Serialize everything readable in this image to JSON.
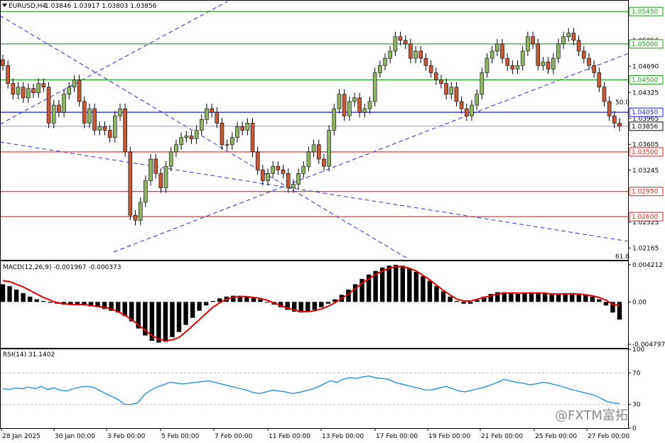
{
  "header": {
    "symbol": "EURUSD,H4",
    "ohlc": "1.03846 1.03917 1.03803 1.03856",
    "triangle_icon": "triangle-down-icon"
  },
  "colors": {
    "bull": "#90b466",
    "bear": "#c25a3a",
    "wick": "#000000",
    "support": "#e02020",
    "resistance": "#1a9a1a",
    "pivot": "#1a1aff",
    "trend": "#2a2acc",
    "macd_line": "#e00000",
    "hist": "#000000",
    "rsi": "#2b8fd6",
    "bid_line": "#8a8ab8"
  },
  "price_axis": {
    "ticks": [
      "1.04325",
      "1.03965",
      "1.03605",
      "1.03245",
      "1.02525",
      "1.02165",
      "1.04690",
      "1.05050"
    ],
    "levels": [
      {
        "label": "1.05450",
        "kind": "resistance"
      },
      {
        "label": "1.05000",
        "kind": "resistance"
      },
      {
        "label": "1.04500",
        "kind": "resistance"
      },
      {
        "label": "1.04050",
        "kind": "pivot"
      },
      {
        "label": "1.03856",
        "kind": "bid"
      },
      {
        "label": "1.03500",
        "kind": "support"
      },
      {
        "label": "1.02950",
        "kind": "support"
      },
      {
        "label": "1.02600",
        "kind": "support"
      }
    ],
    "fib_labels": [
      "50.0",
      "61.8"
    ]
  },
  "macd": {
    "title": "MACD(12,26,9) -0.001967 -0.000373",
    "ticks": [
      "0.004212",
      "0.00",
      "-0.004797"
    ]
  },
  "rsi": {
    "title": "RSI(14) 31.1402",
    "ticks": [
      "100",
      "70",
      "30",
      "0"
    ]
  },
  "dates": [
    "28 Jan 2025",
    "30 Jan 00:00",
    "3 Feb 00:00",
    "5 Feb 00:00",
    "7 Feb 00:00",
    "11 Feb 00:00",
    "13 Feb 00:00",
    "17 Feb 00:00",
    "19 Feb 00:00",
    "21 Feb 00:00",
    "25 Feb 00:00",
    "27 Feb 00:00"
  ],
  "watermark": "@FXTM富拓",
  "chart_data": {
    "type": "candlestick",
    "title": "EURUSD,H4",
    "ylim": [
      1.02,
      1.056
    ],
    "closes": [
      1.047,
      1.0445,
      1.043,
      1.044,
      1.0425,
      1.0438,
      1.0432,
      1.0445,
      1.044,
      1.039,
      1.0415,
      1.0405,
      1.043,
      1.044,
      1.045,
      1.042,
      1.039,
      1.041,
      1.038,
      1.0385,
      1.038,
      1.037,
      1.04,
      1.041,
      1.035,
      1.0262,
      1.0255,
      1.028,
      1.031,
      1.034,
      1.032,
      1.03,
      1.033,
      1.035,
      1.036,
      1.037,
      1.0372,
      1.0368,
      1.038,
      1.0395,
      1.041,
      1.0405,
      1.039,
      1.036,
      1.036,
      1.037,
      1.0385,
      1.038,
      1.039,
      1.035,
      1.0325,
      1.031,
      1.032,
      1.033,
      1.0325,
      1.032,
      1.03,
      1.0305,
      1.032,
      1.033,
      1.035,
      1.036,
      1.034,
      1.033,
      1.038,
      1.041,
      1.043,
      1.04,
      1.042,
      1.0425,
      1.0405,
      1.041,
      1.042,
      1.046,
      1.047,
      1.048,
      1.049,
      1.051,
      1.0505,
      1.05,
      1.048,
      1.049,
      1.048,
      1.047,
      1.046,
      1.045,
      1.0445,
      1.043,
      1.044,
      1.042,
      1.041,
      1.04,
      1.0415,
      1.043,
      1.046,
      1.048,
      1.049,
      1.05,
      1.048,
      1.047,
      1.0465,
      1.047,
      1.049,
      1.051,
      1.05,
      1.047,
      1.0475,
      1.0465,
      1.048,
      1.05,
      1.051,
      1.0515,
      1.0505,
      1.049,
      1.048,
      1.047,
      1.046,
      1.044,
      1.042,
      1.04,
      1.039,
      1.03856
    ],
    "macd_hist": [
      0.002,
      0.0018,
      0.0014,
      0.001,
      0.0006,
      0.0003,
      0.0001,
      -0.0001,
      -0.0002,
      -0.0003,
      -0.0003,
      -0.0004,
      -0.0004,
      -0.0005,
      -0.0006,
      -0.0008,
      -0.001,
      -0.0012,
      -0.0016,
      -0.0022,
      -0.003,
      -0.0038,
      -0.0044,
      -0.0046,
      -0.0045,
      -0.004,
      -0.0034,
      -0.0026,
      -0.0018,
      -0.001,
      -0.0004,
      0.0001,
      0.0004,
      0.0006,
      0.0007,
      0.0007,
      0.0006,
      0.0005,
      0.0003,
      0.0,
      -0.0003,
      -0.0006,
      -0.0009,
      -0.0011,
      -0.0012,
      -0.0011,
      -0.0009,
      -0.0006,
      -0.0002,
      0.0003,
      0.0008,
      0.0014,
      0.002,
      0.0026,
      0.0031,
      0.0035,
      0.0039,
      0.0041,
      0.0042,
      0.0041,
      0.0038,
      0.0034,
      0.0029,
      0.0024,
      0.0018,
      0.0012,
      0.0006,
      0.0001,
      -0.0002,
      -0.0002,
      0.0002,
      0.0006,
      0.0009,
      0.0011,
      0.0011,
      0.001,
      0.0009,
      0.001,
      0.0011,
      0.0011,
      0.001,
      0.0009,
      0.0009,
      0.001,
      0.001,
      0.0009,
      0.0008,
      0.0006,
      0.0003,
      -0.0004,
      -0.0012,
      -0.002
    ],
    "macd_signal": [
      0.0024,
      0.0023,
      0.002,
      0.0017,
      0.0013,
      0.0009,
      0.0005,
      0.0002,
      -0.0001,
      -0.0002,
      -0.0003,
      -0.0003,
      -0.0003,
      -0.0004,
      -0.0005,
      -0.0006,
      -0.0008,
      -0.0011,
      -0.0015,
      -0.002,
      -0.0026,
      -0.0032,
      -0.0038,
      -0.0042,
      -0.0044,
      -0.0043,
      -0.004,
      -0.0034,
      -0.0027,
      -0.002,
      -0.0013,
      -0.0006,
      -0.0001,
      0.0003,
      0.0005,
      0.0006,
      0.0006,
      0.0005,
      0.0004,
      0.0002,
      -0.0001,
      -0.0004,
      -0.0007,
      -0.0009,
      -0.0011,
      -0.0011,
      -0.001,
      -0.0008,
      -0.0005,
      -0.0001,
      0.0004,
      0.0009,
      0.0015,
      0.0021,
      0.0026,
      0.0031,
      0.0035,
      0.0038,
      0.004,
      0.004,
      0.0038,
      0.0035,
      0.003,
      0.0025,
      0.0019,
      0.0013,
      0.0008,
      0.0003,
      0.0001,
      0.0001,
      0.0003,
      0.0005,
      0.0007,
      0.0009,
      0.001,
      0.001,
      0.001,
      0.001,
      0.001,
      0.001,
      0.001,
      0.0009,
      0.0009,
      0.0009,
      0.0009,
      0.0009,
      0.0008,
      0.0007,
      0.0005,
      0.0002,
      -0.0003,
      -0.0004
    ],
    "rsi": [
      50,
      49,
      51,
      50,
      52,
      50,
      53,
      49,
      51,
      48,
      47,
      50,
      52,
      53,
      52,
      48,
      44,
      40,
      36,
      30,
      30,
      32,
      42,
      48,
      52,
      55,
      58,
      57,
      56,
      57,
      58,
      59,
      60,
      58,
      56,
      54,
      52,
      50,
      48,
      45,
      44,
      46,
      48,
      47,
      46,
      44,
      45,
      47,
      49,
      52,
      56,
      60,
      58,
      62,
      64,
      63,
      65,
      66,
      64,
      63,
      62,
      58,
      56,
      54,
      52,
      50,
      48,
      49,
      51,
      53,
      50,
      47,
      46,
      48,
      50,
      52,
      55,
      58,
      62,
      60,
      58,
      57,
      55,
      56,
      58,
      57,
      55,
      53,
      50,
      48,
      46,
      44,
      42,
      38,
      34,
      32,
      31
    ],
    "xlabel": "",
    "ylabel": ""
  }
}
